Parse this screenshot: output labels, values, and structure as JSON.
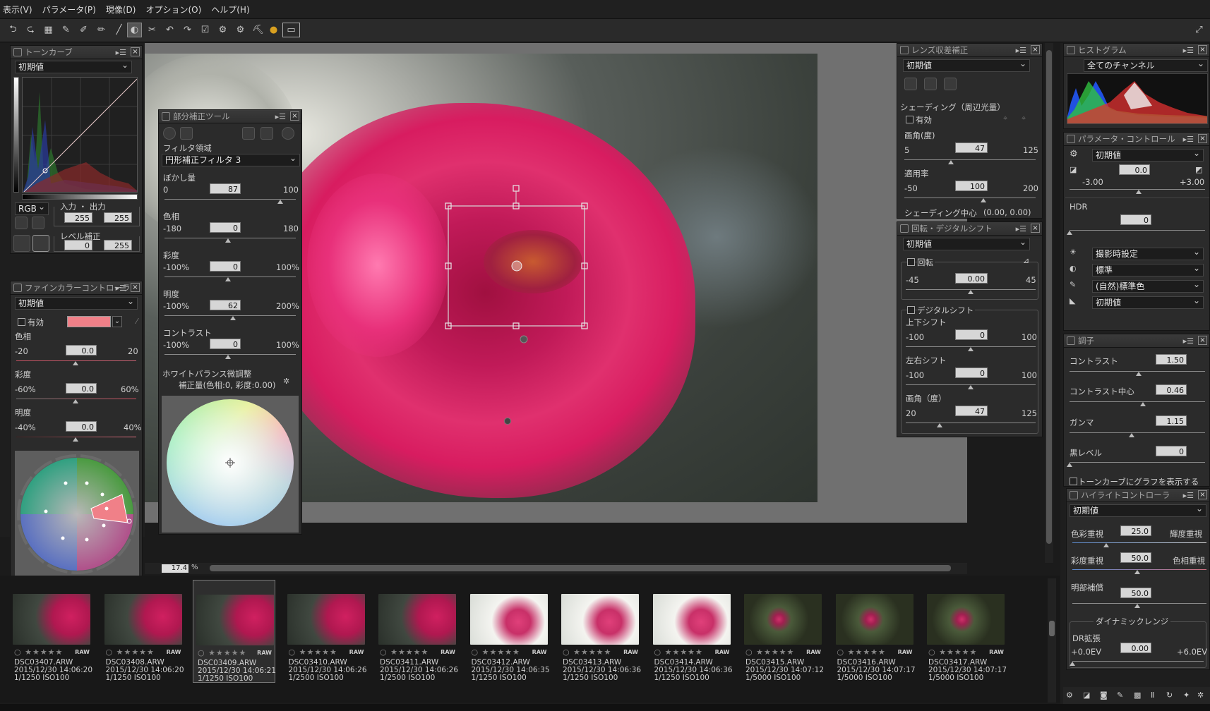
{
  "menu": [
    "表示(V)",
    "パラメータ(P)",
    "現像(D)",
    "オプション(O)",
    "ヘルプ(H)"
  ],
  "tone_curve": {
    "title": "トーンカーブ",
    "preset": "初期値",
    "channel": "RGB",
    "io_label": "入力 ・ 出力",
    "in_val": "255",
    "out_val": "255",
    "level_label": "レベル補正",
    "level_lo": "0",
    "level_hi": "255",
    "axis_lo": "0",
    "axis_hi": "255"
  },
  "fine_color": {
    "title": "ファインカラーコントローラ",
    "preset": "初期値",
    "enable": "有効",
    "hue_label": "色相",
    "hue_min": "-20",
    "hue_val": "0.0",
    "hue_max": "20",
    "sat_label": "彩度",
    "sat_min": "-60%",
    "sat_val": "0.0",
    "sat_max": "60%",
    "bri_label": "明度",
    "bri_min": "-40%",
    "bri_val": "0.0",
    "bri_max": "40%",
    "swatch": "#f08088"
  },
  "partial": {
    "title": "部分補正ツール",
    "filter_label": "フィルタ領域",
    "filter_val": "円形補正フィルタ 3",
    "sliders": [
      {
        "label": "ぼかし量",
        "min": "0",
        "val": "87",
        "max": "100"
      },
      {
        "label": "色相",
        "min": "-180",
        "val": "0",
        "max": "180"
      },
      {
        "label": "彩度",
        "min": "-100%",
        "val": "0",
        "max": "100%"
      },
      {
        "label": "明度",
        "min": "-100%",
        "val": "62",
        "max": "200%"
      },
      {
        "label": "コントラスト",
        "min": "-100%",
        "val": "0",
        "max": "100%"
      }
    ],
    "wb_label": "ホワイトバランス微調整",
    "wb_sub": "補正量(色相:0, 彩度:0.00)"
  },
  "lens": {
    "title": "レンズ収差補正",
    "preset": "初期値",
    "shading_label": "シェーディング（周辺光量）",
    "enable": "有効",
    "angle_label": "画角(度)",
    "angle_min": "5",
    "angle_val": "47",
    "angle_max": "125",
    "rate_label": "適用率",
    "rate_min": "-50",
    "rate_val": "100",
    "rate_max": "200",
    "center_label": "シェーディング中心",
    "center_val": "(0.00, 0.00)"
  },
  "rotate": {
    "title": "回転・デジタルシフト",
    "preset": "初期値",
    "rot_label": "回転",
    "rot_min": "-45",
    "rot_val": "0.00",
    "rot_max": "45",
    "shift_label": "デジタルシフト",
    "ud_label": "上下シフト",
    "ud_min": "-100",
    "ud_val": "0",
    "ud_max": "100",
    "lr_label": "左右シフト",
    "lr_min": "-100",
    "lr_val": "0",
    "lr_max": "100",
    "ang_label": "画角（度）",
    "ang_min": "20",
    "ang_val": "47",
    "ang_max": "125"
  },
  "histogram": {
    "title": "ヒストグラム",
    "channel": "全てのチャンネル"
  },
  "param": {
    "title": "パラメータ・コントロール",
    "preset": "初期値",
    "exp_val": "0.0",
    "exp_min": "-3.00",
    "exp_max": "+3.00",
    "hdr_label": "HDR",
    "hdr_val": "0",
    "wb": "撮影時設定",
    "style": "標準",
    "color": "(自然)標準色",
    "tone": "初期値"
  },
  "tone": {
    "title": "調子",
    "contrast_label": "コントラスト",
    "contrast_val": "1.50",
    "center_label": "コントラスト中心",
    "center_val": "0.46",
    "gamma_label": "ガンマ",
    "gamma_val": "1.15",
    "black_label": "黒レベル",
    "black_val": "0",
    "show_graph": "トーンカーブにグラフを表示する"
  },
  "highlight": {
    "title": "ハイライトコントローラ",
    "preset": "初期値",
    "a_left": "色彩重視",
    "a_val": "25.0",
    "a_right": "輝度重視",
    "b_left": "彩度重視",
    "b_val": "50.0",
    "b_right": "色相重視",
    "c_label": "明部補償",
    "c_val": "50.0",
    "dr_group": "ダイナミックレンジ",
    "dr_label": "DR拡張",
    "dr_val": "0.00",
    "dr_min": "+0.0EV",
    "dr_max": "+6.0EV"
  },
  "zoom": "17.4",
  "zoom_unit": "%",
  "filmstrip": [
    {
      "name": "DSC03407.ARW",
      "date": "2015/12/30 14:06:20",
      "exp": "1/1250 ISO100",
      "tone": "dark"
    },
    {
      "name": "DSC03408.ARW",
      "date": "2015/12/30 14:06:20",
      "exp": "1/1250 ISO100",
      "tone": "dark"
    },
    {
      "name": "DSC03409.ARW",
      "date": "2015/12/30 14:06:21",
      "exp": "1/1250 ISO100",
      "tone": "dark"
    },
    {
      "name": "DSC03410.ARW",
      "date": "2015/12/30 14:06:26",
      "exp": "1/2500 ISO100",
      "tone": "dark"
    },
    {
      "name": "DSC03411.ARW",
      "date": "2015/12/30 14:06:26",
      "exp": "1/2500 ISO100",
      "tone": "dark"
    },
    {
      "name": "DSC03412.ARW",
      "date": "2015/12/30 14:06:35",
      "exp": "1/1250 ISO100",
      "tone": "bright"
    },
    {
      "name": "DSC03413.ARW",
      "date": "2015/12/30 14:06:36",
      "exp": "1/1250 ISO100",
      "tone": "bright"
    },
    {
      "name": "DSC03414.ARW",
      "date": "2015/12/30 14:06:36",
      "exp": "1/1250 ISO100",
      "tone": "bright"
    },
    {
      "name": "DSC03415.ARW",
      "date": "2015/12/30 14:07:12",
      "exp": "1/5000 ISO100",
      "tone": "bokeh"
    },
    {
      "name": "DSC03416.ARW",
      "date": "2015/12/30 14:07:17",
      "exp": "1/5000 ISO100",
      "tone": "bokeh"
    },
    {
      "name": "DSC03417.ARW",
      "date": "2015/12/30 14:07:17",
      "exp": "1/5000 ISO100",
      "tone": "bokeh"
    }
  ],
  "stars": "○ ★★★★★",
  "raw": "RAW"
}
